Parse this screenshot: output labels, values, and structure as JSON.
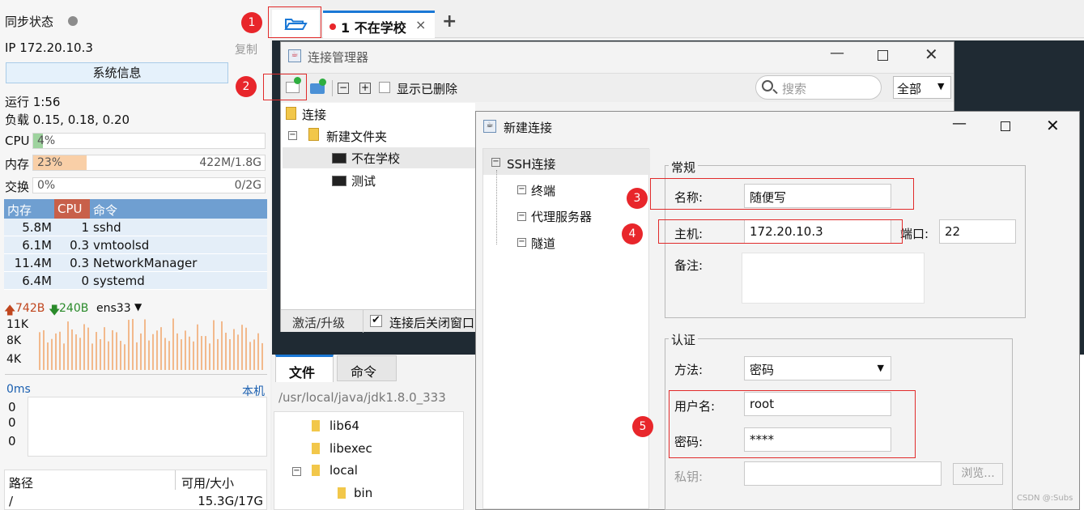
{
  "sidebar": {
    "sync_label": "同步状态",
    "ip": "IP 172.20.10.3",
    "copy": "复制",
    "sysinfo_button": "系统信息",
    "uptime": "运行 1:56",
    "load": "负载 0.15, 0.18, 0.20",
    "cpu": {
      "label": "CPU",
      "pct": "4%",
      "value": 0.04
    },
    "mem": {
      "label": "内存",
      "pct": "23%",
      "detail": "422M/1.8G",
      "value": 0.23
    },
    "swap": {
      "label": "交换",
      "pct": "0%",
      "detail": "0/2G",
      "value": 0
    },
    "proc_headers": {
      "mem": "内存",
      "cpu": "CPU",
      "cmd": "命令"
    },
    "processes": [
      {
        "mem": "5.8M",
        "cpu": "1",
        "cmd": "sshd"
      },
      {
        "mem": "6.1M",
        "cpu": "0.3",
        "cmd": "vmtoolsd"
      },
      {
        "mem": "11.4M",
        "cpu": "0.3",
        "cmd": "NetworkManager"
      },
      {
        "mem": "6.4M",
        "cpu": "0",
        "cmd": "systemd"
      }
    ],
    "net": {
      "up": "742B",
      "down": "240B",
      "iface": "ens33"
    },
    "net_ticks": [
      "11K",
      "8K",
      "4K"
    ],
    "latency": {
      "label": "0ms",
      "host": "本机",
      "vals": [
        "0",
        "0",
        "0"
      ]
    },
    "disk": {
      "col_path": "路径",
      "col_size": "可用/大小",
      "path": "/",
      "size": "15.3G/17G"
    }
  },
  "tabs": {
    "session_tab": "1 不在学校",
    "close": "×",
    "add": "+"
  },
  "conn_manager": {
    "title": "连接管理器",
    "show_deleted": "显示已删除",
    "search_placeholder": "搜索",
    "filter": "全部",
    "tree": {
      "root": "连接",
      "folder": "新建文件夹",
      "item1": "不在学校",
      "item2": "测试"
    },
    "activate": "激活/升级",
    "close_after": "连接后关闭窗口"
  },
  "file_panel": {
    "tab_files": "文件",
    "tab_cmd": "命令",
    "path": "/usr/local/java/jdk1.8.0_333",
    "items": [
      "lib64",
      "libexec",
      "local",
      "bin"
    ]
  },
  "new_conn": {
    "title": "新建连接",
    "nav": {
      "ssh": "SSH连接",
      "terminal": "终端",
      "proxy": "代理服务器",
      "tunnel": "隧道"
    },
    "general": "常规",
    "name_label": "名称:",
    "name_value": "随便写",
    "host_label": "主机:",
    "host_value": "172.20.10.3",
    "port_label": "端口:",
    "port_value": "22",
    "note_label": "备注:",
    "auth": "认证",
    "method_label": "方法:",
    "method_value": "密码",
    "user_label": "用户名:",
    "user_value": "root",
    "pass_label": "密码:",
    "pass_value": "****",
    "key_label": "私钥:",
    "browse": "浏览..."
  },
  "badges": [
    "1",
    "2",
    "3",
    "4",
    "5"
  ],
  "watermark": "CSDN @:Subs",
  "colors": {
    "accent": "#1a78d6",
    "badge": "#e8262b",
    "proc_header": "#6f9fd1",
    "mem_fill": "#f9cfa7",
    "cpu_fill": "#9ed39e"
  }
}
